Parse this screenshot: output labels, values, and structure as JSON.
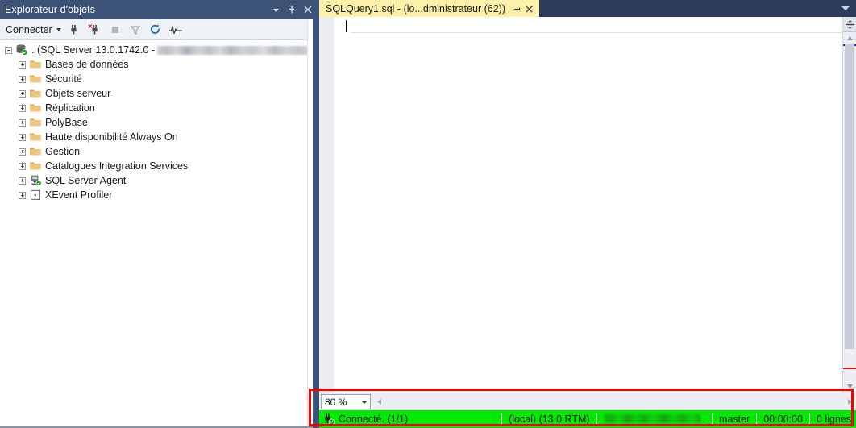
{
  "object_explorer": {
    "title": "Explorateur d'objets",
    "titlebar_buttons": [
      {
        "name": "window-dropdown-icon",
        "glyph": "caret-down"
      },
      {
        "name": "pin-icon",
        "glyph": "pin"
      },
      {
        "name": "close-icon",
        "glyph": "close"
      }
    ],
    "toolbar": {
      "connect_label": "Connecter",
      "buttons": [
        {
          "name": "connect-plug-icon",
          "title": "Connexion"
        },
        {
          "name": "disconnect-plug-icon",
          "title": "Déconnexion"
        },
        {
          "name": "stop-icon",
          "title": "Arrêter"
        },
        {
          "name": "filter-icon",
          "title": "Filtrer"
        },
        {
          "name": "refresh-icon",
          "title": "Actualiser"
        },
        {
          "name": "activity-monitor-icon",
          "title": "Moniteur d'activité"
        }
      ]
    },
    "tree": {
      "root": {
        "label": ". (SQL Server 13.0.1742.0 - ",
        "icon": "server-icon",
        "expander": "minus",
        "redacted": true,
        "redacted_width": 195
      },
      "children": [
        {
          "label": "Bases de données",
          "icon": "folder-icon",
          "expander": "plus"
        },
        {
          "label": "Sécurité",
          "icon": "folder-icon",
          "expander": "plus"
        },
        {
          "label": "Objets serveur",
          "icon": "folder-icon",
          "expander": "plus"
        },
        {
          "label": "Réplication",
          "icon": "folder-icon",
          "expander": "plus"
        },
        {
          "label": "PolyBase",
          "icon": "folder-icon",
          "expander": "plus"
        },
        {
          "label": "Haute disponibilité Always On",
          "icon": "folder-icon",
          "expander": "plus"
        },
        {
          "label": "Gestion",
          "icon": "folder-icon",
          "expander": "plus"
        },
        {
          "label": "Catalogues Integration Services",
          "icon": "folder-icon",
          "expander": "plus"
        },
        {
          "label": "SQL Server Agent",
          "icon": "agent-icon",
          "expander": "plus"
        },
        {
          "label": "XEvent Profiler",
          "icon": "xevent-icon",
          "expander": "plus"
        }
      ]
    }
  },
  "editor": {
    "tab": {
      "label": "SQLQuery1.sql - (lo...dministrateur (62))",
      "pin_icon": "pin-icon",
      "close_icon": "close-icon"
    },
    "tabstrip_overflow_icon": "chevron-down-icon",
    "split_button_icon": "split-editor-icon",
    "content": "",
    "zoom": {
      "value": "80 %",
      "caret_icon": "chevron-down-icon"
    },
    "hscroll": {
      "left_icon": "arrow-left-icon",
      "right_icon": "arrow-right-icon"
    },
    "vscroll": {
      "up_icon": "arrow-up-icon",
      "down_icon": "arrow-down-icon"
    }
  },
  "status_bar": {
    "icon": "connected-plug-icon",
    "connection_state": "Connecté. (1/1)",
    "server": "(local) (13.0 RTM)",
    "user_redacted": true,
    "user_suffix": ".",
    "database": "master",
    "elapsed": "00:00:00",
    "rows": "0 lignes",
    "background_color": "#00ea00"
  },
  "annotation": {
    "name": "red-highlight-rectangle",
    "color": "#f50000"
  },
  "theme": {
    "panel_title_bg": "#3d5277",
    "tabstrip_bg": "#2d3c5b",
    "active_tab_bg": "#fdf0a8",
    "toolbar_bg": "#eef1f6"
  }
}
